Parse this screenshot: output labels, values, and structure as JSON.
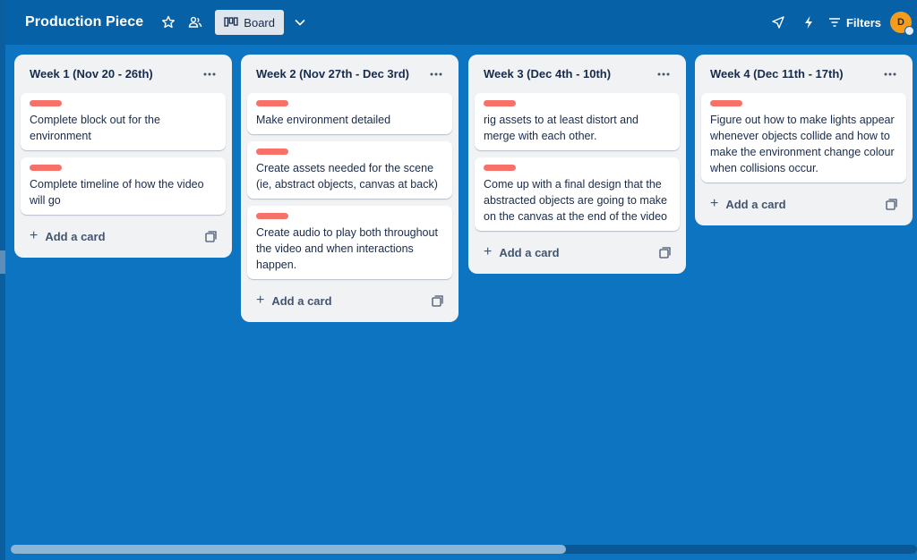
{
  "header": {
    "board_title": "Production Piece",
    "view_label": "Board",
    "filters_label": "Filters",
    "avatar_initial": "D"
  },
  "lists": [
    {
      "title": "Week 1 (Nov 20 - 26th)",
      "cards": [
        {
          "text": "Complete block out for the environment"
        },
        {
          "text": "Complete timeline of how the video will go"
        }
      ],
      "add_label": "Add a card"
    },
    {
      "title": "Week 2 (Nov 27th - Dec 3rd)",
      "cards": [
        {
          "text": "Make environment detailed"
        },
        {
          "text": "Create assets needed for the scene (ie, abstract objects, canvas at back)"
        },
        {
          "text": "Create audio to play both throughout the video and when interactions happen."
        }
      ],
      "add_label": "Add a card"
    },
    {
      "title": "Week 3 (Dec 4th - 10th)",
      "cards": [
        {
          "text": "rig assets to at least distort and merge with each other."
        },
        {
          "text": "Come up with a final design that the abstracted objects are going to make on the canvas at the end of the video"
        }
      ],
      "add_label": "Add a card"
    },
    {
      "title": "Week 4 (Dec 11th - 17th)",
      "cards": [
        {
          "text": "Figure out how to make lights appear whenever objects collide and how to make the environment change colour when collisions occur."
        }
      ],
      "add_label": "Add a card"
    }
  ],
  "colors": {
    "board_background": "#0d74c2",
    "header_background": "#0761a7",
    "label_red": "#f87168",
    "avatar": "#f59c1a"
  },
  "scrollbar": {
    "position_fraction": 0.61
  }
}
